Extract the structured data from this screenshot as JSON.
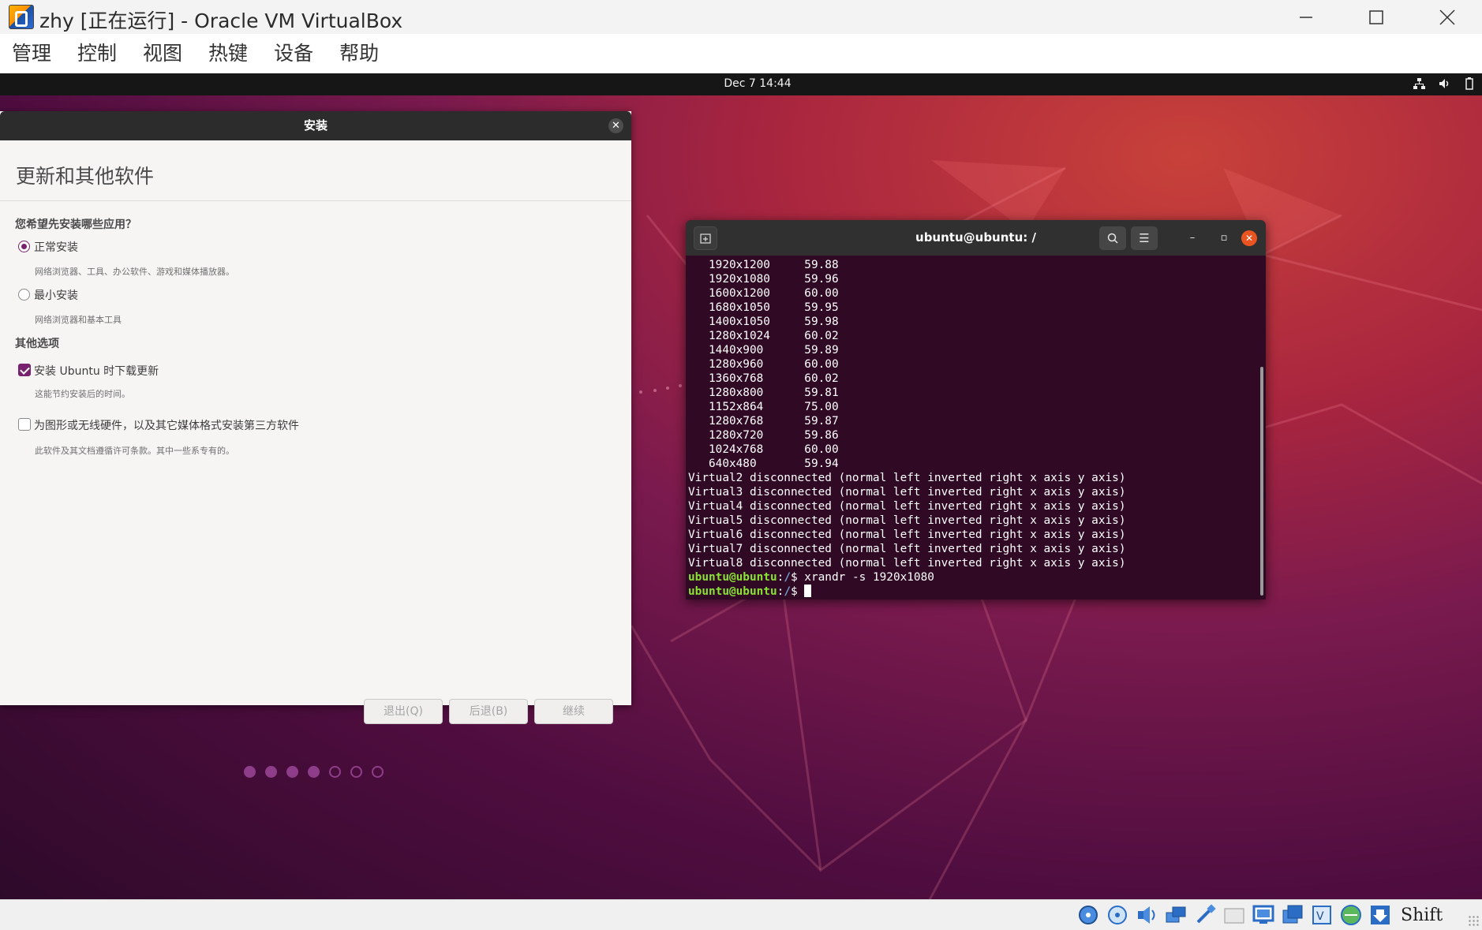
{
  "window": {
    "title": "zhy [正在运行] - Oracle VM VirtualBox",
    "menu": [
      "管理",
      "控制",
      "视图",
      "热键",
      "设备",
      "帮助"
    ]
  },
  "guest_topbar": {
    "clock": "Dec 7  14:44",
    "tray_icons": [
      "network-icon",
      "volume-icon",
      "battery-icon"
    ]
  },
  "installer": {
    "title": "安装",
    "heading": "更新和其他软件",
    "question": "您希望先安装哪些应用？",
    "options": [
      {
        "label": "正常安装",
        "desc": "网络浏览器、工具、办公软件、游戏和媒体播放器。",
        "selected": true
      },
      {
        "label": "最小安装",
        "desc": "网络浏览器和基本工具",
        "selected": false
      }
    ],
    "other_heading": "其他选项",
    "checks": [
      {
        "label": "安装 Ubuntu 时下载更新",
        "desc": "这能节约安装后的时间。",
        "checked": true
      },
      {
        "label": "为图形或无线硬件，以及其它媒体格式安装第三方软件",
        "desc": "此软件及其文档遵循许可条款。其中一些系专有的。",
        "checked": false
      }
    ],
    "buttons": {
      "quit": "退出(Q)",
      "back": "后退(B)",
      "continue": "继续"
    },
    "progress": {
      "current": 4,
      "total": 7
    }
  },
  "terminal": {
    "title": "ubuntu@ubuntu: /",
    "modes": [
      [
        "1920x1200",
        "59.88"
      ],
      [
        "1920x1080",
        "59.96"
      ],
      [
        "1600x1200",
        "60.00"
      ],
      [
        "1680x1050",
        "59.95"
      ],
      [
        "1400x1050",
        "59.98"
      ],
      [
        "1280x1024",
        "60.02"
      ],
      [
        "1440x900",
        "59.89"
      ],
      [
        "1280x960",
        "60.00"
      ],
      [
        "1360x768",
        "60.02"
      ],
      [
        "1280x800",
        "59.81"
      ],
      [
        "1152x864",
        "75.00"
      ],
      [
        "1280x768",
        "59.87"
      ],
      [
        "1280x720",
        "59.86"
      ],
      [
        "1024x768",
        "60.00"
      ],
      [
        "640x480",
        "59.94"
      ]
    ],
    "outputs": [
      "Virtual2 disconnected (normal left inverted right x axis y axis)",
      "Virtual3 disconnected (normal left inverted right x axis y axis)",
      "Virtual4 disconnected (normal left inverted right x axis y axis)",
      "Virtual5 disconnected (normal left inverted right x axis y axis)",
      "Virtual6 disconnected (normal left inverted right x axis y axis)",
      "Virtual7 disconnected (normal left inverted right x axis y axis)",
      "Virtual8 disconnected (normal left inverted right x axis y axis)"
    ],
    "prompt_user": "ubuntu@ubuntu",
    "prompt_sep": ":",
    "prompt_path": "/",
    "prompt_dollar": "$ ",
    "command": "xrandr -s 1920x1080"
  },
  "status_bar": {
    "icons": [
      "hard-disk-icon",
      "optical-disc-icon",
      "audio-icon",
      "network-icon",
      "usb-icon",
      "shared-folder-icon",
      "display-icon",
      "video-capture-icon",
      "vt-x-icon",
      "guest-additions-icon",
      "download-icon"
    ],
    "host_key": "Shift"
  },
  "colors": {
    "ubuntu_purple": "#77216f",
    "terminal_bg": "#300a24",
    "close_orange": "#e95420"
  }
}
